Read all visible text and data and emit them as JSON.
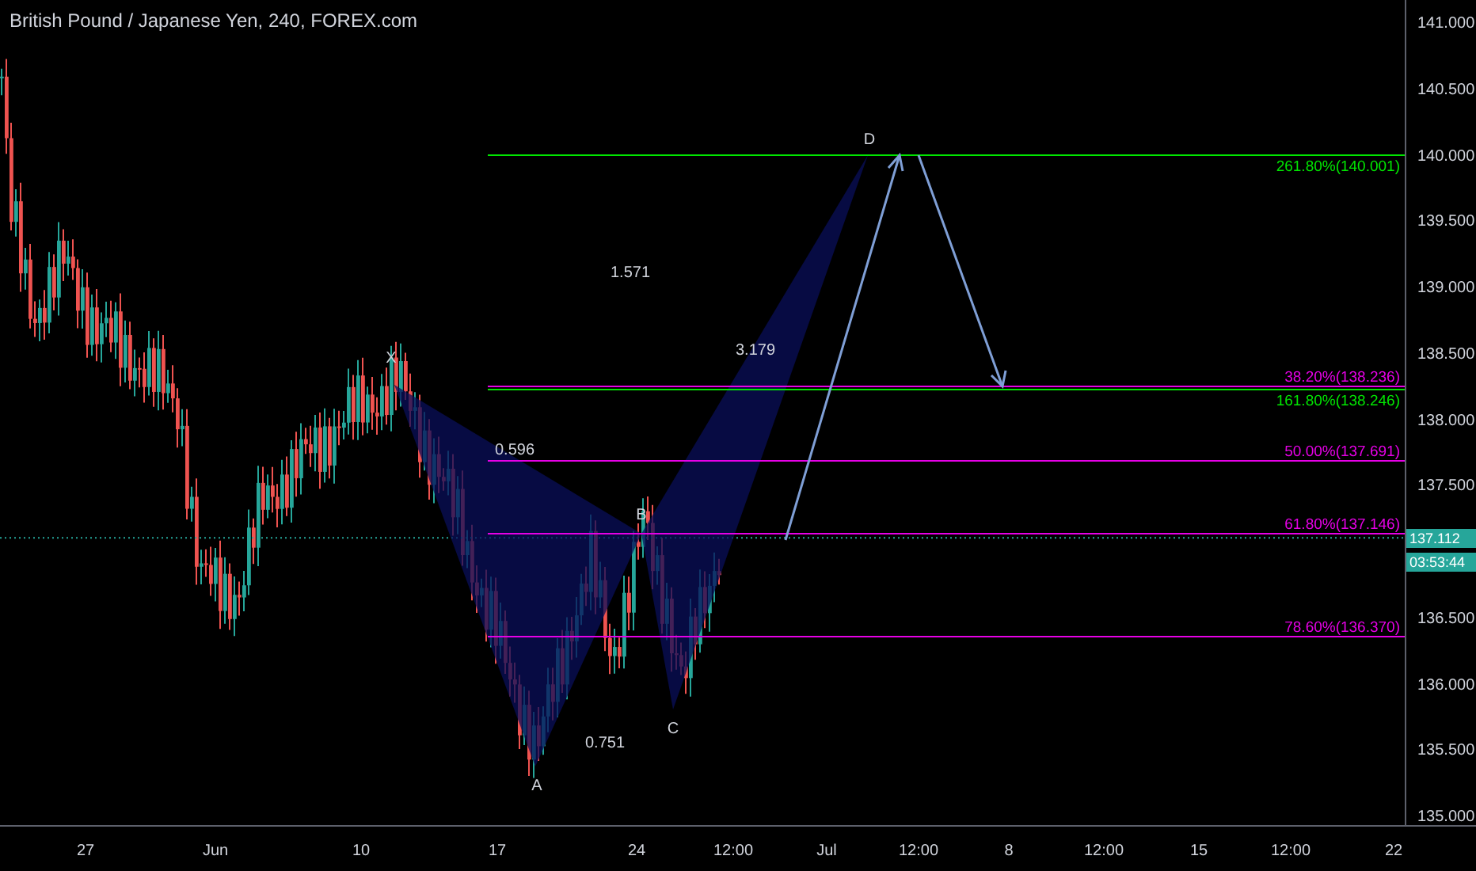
{
  "title": "British Pound / Japanese Yen, 240, FOREX.com",
  "fib_levels": [
    {
      "label": "261.80%(140.001)",
      "color": "#00e600"
    },
    {
      "label": "38.20%(138.236)",
      "color": "#e600e6"
    },
    {
      "label": "161.80%(138.246)",
      "color": "#00e600"
    },
    {
      "label": "50.00%(137.691)",
      "color": "#e600e6"
    },
    {
      "label": "61.80%(137.146)",
      "color": "#e600e6"
    },
    {
      "label": "78.60%(136.370)",
      "color": "#e600e6"
    }
  ],
  "pattern": {
    "points": [
      "X",
      "A",
      "B",
      "C",
      "D"
    ],
    "ratios": [
      "1.571",
      "3.179",
      "0.596",
      "0.751"
    ]
  },
  "price_axis": {
    "labels": [
      "141.000",
      "140.500",
      "140.000",
      "139.500",
      "139.000",
      "138.500",
      "138.000",
      "137.500",
      "136.500",
      "136.000",
      "135.500",
      "135.000"
    ],
    "last_price": "137.112",
    "countdown": "03:53:44"
  },
  "time_axis": {
    "labels": [
      "27",
      "Jun",
      "10",
      "17",
      "24",
      "12:00",
      "Jul",
      "12:00",
      "8",
      "12:00",
      "15",
      "12:00",
      "22"
    ]
  }
}
